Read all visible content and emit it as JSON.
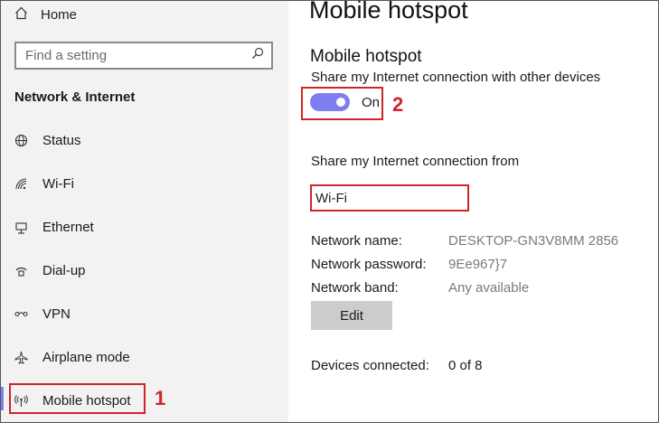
{
  "sidebar": {
    "home_label": "Home",
    "search_placeholder": "Find a setting",
    "section_title": "Network & Internet",
    "items": [
      {
        "label": "Status",
        "icon": "globe-icon"
      },
      {
        "label": "Wi-Fi",
        "icon": "wifi-icon"
      },
      {
        "label": "Ethernet",
        "icon": "ethernet-icon"
      },
      {
        "label": "Dial-up",
        "icon": "dialup-icon"
      },
      {
        "label": "VPN",
        "icon": "vpn-icon"
      },
      {
        "label": "Airplane mode",
        "icon": "airplane-icon"
      },
      {
        "label": "Mobile hotspot",
        "icon": "hotspot-icon",
        "selected": true
      }
    ]
  },
  "main": {
    "page_title": "Mobile hotspot",
    "section_title": "Mobile hotspot",
    "share_label": "Share my Internet connection with other devices",
    "toggle_state": "On",
    "share_from_label": "Share my Internet connection from",
    "share_from_value": "Wi-Fi",
    "details": {
      "network_name_label": "Network name:",
      "network_name_value": "DESKTOP-GN3V8MM 2856",
      "network_password_label": "Network password:",
      "network_password_value": "9Ee967}7",
      "network_band_label": "Network band:",
      "network_band_value": "Any available"
    },
    "edit_label": "Edit",
    "devices_label": "Devices connected:",
    "devices_value": "0 of 8"
  },
  "annotations": {
    "step1": "1",
    "step2": "2"
  },
  "colors": {
    "accent": "#7e7ef0",
    "highlight": "#d1232a",
    "sidebar_bg": "#f2f2f2"
  }
}
